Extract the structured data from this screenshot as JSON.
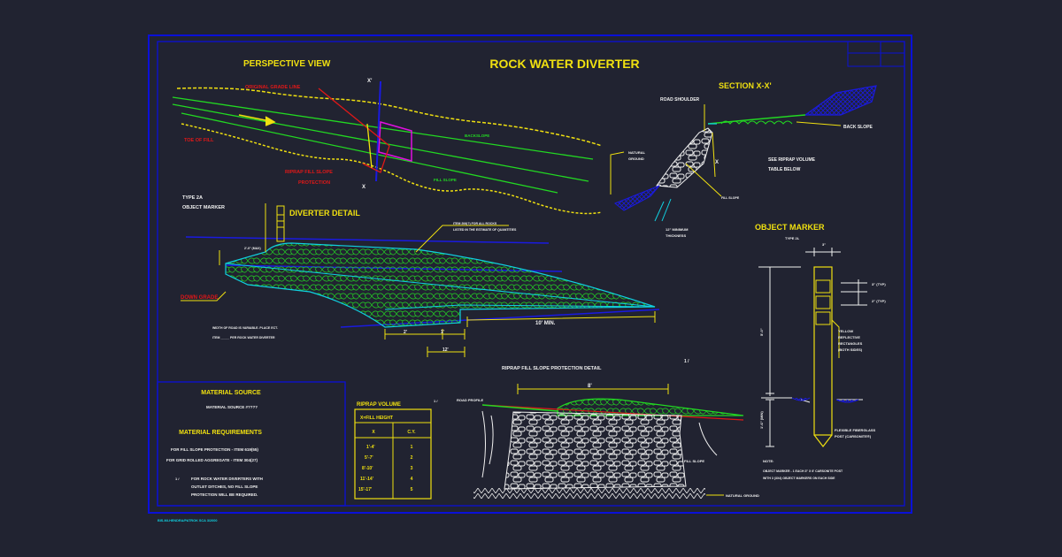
{
  "drawing": {
    "title": "ROCK WATER DIVERTER",
    "footer": "BIS-MI-HENDRA/PATROK   SCA   3/2000",
    "stray_marks": [
      "1 /",
      "1 /"
    ]
  },
  "perspective": {
    "heading": "PERSPECTIVE VIEW",
    "labels": {
      "original_grade_line": "ORIGINAL GRADE LINE",
      "toe_of_fill": "TOE OF FILL",
      "riprap_line1": "RIPRAP FILL SLOPE",
      "riprap_line2": "PROTECTION",
      "backslope": "BACKSLOPE",
      "fill_slope": "FILL SLOPE",
      "x_top": "X'",
      "x_bottom": "X"
    }
  },
  "section": {
    "heading": "SECTION X-X'",
    "labels": {
      "road_shoulder": "ROAD SHOULDER",
      "back_slope": "BACK SLOPE",
      "natural_ground_1": "NATURAL",
      "natural_ground_2": "GROUND",
      "see_riprap_1": "SEE RIPRAP VOLUME",
      "see_riprap_2": "TABLE BELOW",
      "x": "X",
      "fill_slope": "FILL SLOPE",
      "min_thick_1": "12\" MINIMUM",
      "min_thick_2": "THICKNESS"
    }
  },
  "diverter": {
    "heading": "DIVERTER DETAIL",
    "type_label": "TYPE 2A",
    "object_marker_label": "OBJECT MARKER",
    "down_grade": "DOWN GRADE",
    "item_note_1": "ITEM 206(?) FOR ALL ROCKS",
    "item_note_2": "LISTED IN THE ESTIMATE OF QUANTITIES",
    "width_note_1": "WIDTH OF ROAD IS VARIABLE. PLACE ECT.",
    "width_note_2": "ITEM _____ PER ROCK WATER DIVERTER",
    "dim_10_min": "10' MIN.",
    "dim_2": "2'",
    "dim_1": "1'",
    "dim_12": "12'",
    "dim_top": "2'-0\" (MAX)"
  },
  "fill_detail": {
    "heading": "RIPRAP FILL SLOPE PROTECTION DETAIL",
    "dim": "8'",
    "road_profile": "ROAD PROFILE",
    "fill_slope": "FILL SLOPE",
    "natural_ground": "NATURAL GROUND"
  },
  "object_marker": {
    "heading": "OBJECT MARKER",
    "sub": "TYPE 2L",
    "dim_top": "3\"",
    "dim_typ_1": "3\" (TYP)",
    "dim_typ_2": "2\" (TYP)",
    "height": "5'-0\"",
    "depth": "1'-6\" (MIN)",
    "yellow_1": "YELLOW",
    "yellow_2": "REFLECTIVE",
    "yellow_3": "RECTANGLES",
    "yellow_4": "(BOTH SIDES)",
    "post_1": "FLEXIBLE FIBERGLASS",
    "post_2": "POST (CARSONITE®)",
    "note_head": "NOTE:",
    "note_1": "OBJECT MARKER - 1 EACH 3\" X 6' CARSONITE POST",
    "note_2": "WITH 3 (3X4) OBJECT MARKERS ON EACH SIDE"
  },
  "material": {
    "source_heading": "MATERIAL SOURCE",
    "source_value": "MATERIAL SOURCE #????",
    "req_heading": "MATERIAL REQUIREMENTS",
    "req_1": "FOR FILL SLOPE PROTECTION - ITEM 619(55)",
    "req_2": "FOR GRID ROLLED AGGREGATE - ITEM 304(27)",
    "note_mark": "1 /",
    "note_1": "FOR ROCK WATER DIVERTERS WITH",
    "note_2": "OUTLET DITCHES, NO FILL SLOPE",
    "note_3": "PROTECTION WILL BE REQUIRED."
  },
  "riprap_table": {
    "title": "RIPRAP VOLUME",
    "subtitle": "X=FILL HEIGHT",
    "col_x": "X",
    "col_cy": "C.Y.",
    "rows": [
      {
        "x": "1'-4'",
        "cy": "1"
      },
      {
        "x": "5'-7'",
        "cy": "2"
      },
      {
        "x": "8'-10'",
        "cy": "3"
      },
      {
        "x": "11'-14'",
        "cy": "4"
      },
      {
        "x": "15'-17'",
        "cy": "5"
      }
    ]
  },
  "colors": {
    "background": "#212331",
    "border": "#0a10d8",
    "yellow": "#f0e010",
    "green": "#22d822",
    "cyan": "#10d0e0",
    "red": "#e01818",
    "magenta": "#e010e0",
    "white": "#f0f0f0",
    "blue": "#1a1ae0"
  }
}
